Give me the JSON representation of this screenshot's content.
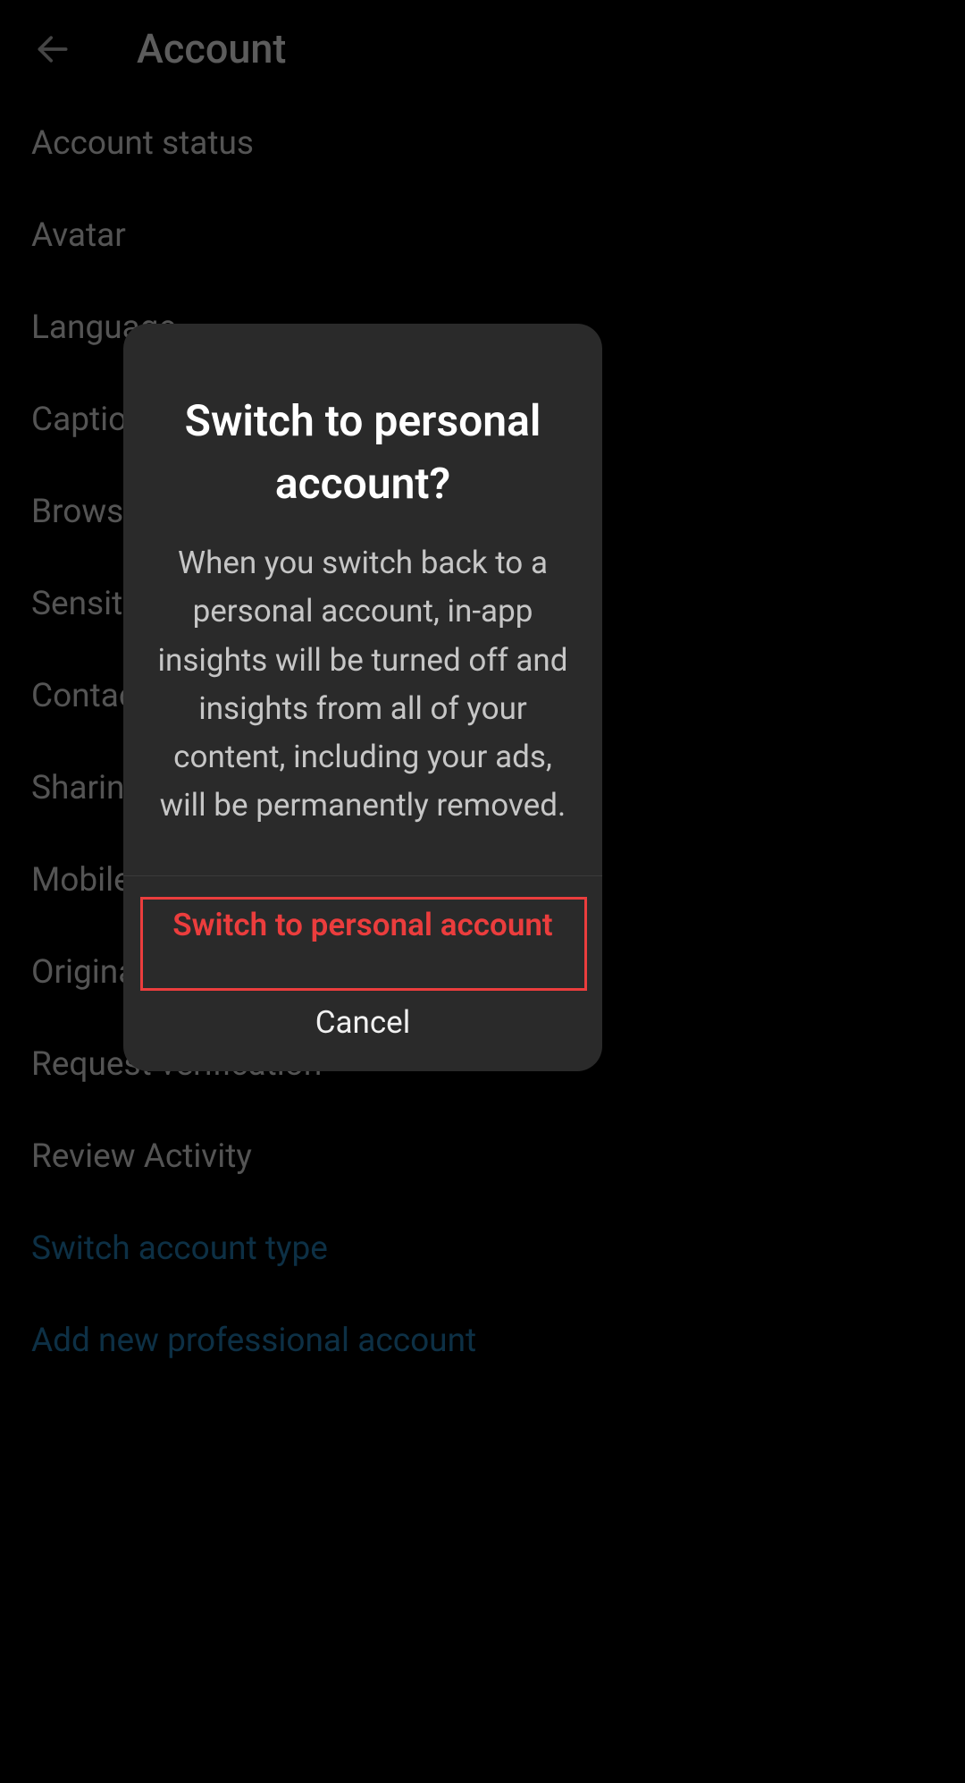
{
  "header": {
    "title": "Account"
  },
  "settings": {
    "items": [
      {
        "label": "Account status",
        "link": false
      },
      {
        "label": "Avatar",
        "link": false
      },
      {
        "label": "Language",
        "link": false
      },
      {
        "label": "Captions",
        "link": false
      },
      {
        "label": "Browser settings",
        "link": false
      },
      {
        "label": "Sensitive content control",
        "link": false
      },
      {
        "label": "Contacts syncing",
        "link": false
      },
      {
        "label": "Sharing to other apps",
        "link": false
      },
      {
        "label": "Mobile data use",
        "link": false
      },
      {
        "label": "Original posts",
        "link": false
      },
      {
        "label": "Request verification",
        "link": false
      },
      {
        "label": "Review Activity",
        "link": false
      },
      {
        "label": "Switch account type",
        "link": true
      },
      {
        "label": "Add new professional account",
        "link": true
      }
    ]
  },
  "dialog": {
    "title": "Switch to personal account?",
    "body": "When you switch back to a personal account, in-app insights will be turned off and insights from all of your content, including your ads, will be permanently removed.",
    "confirm_label": "Switch to personal account",
    "cancel_label": "Cancel"
  }
}
